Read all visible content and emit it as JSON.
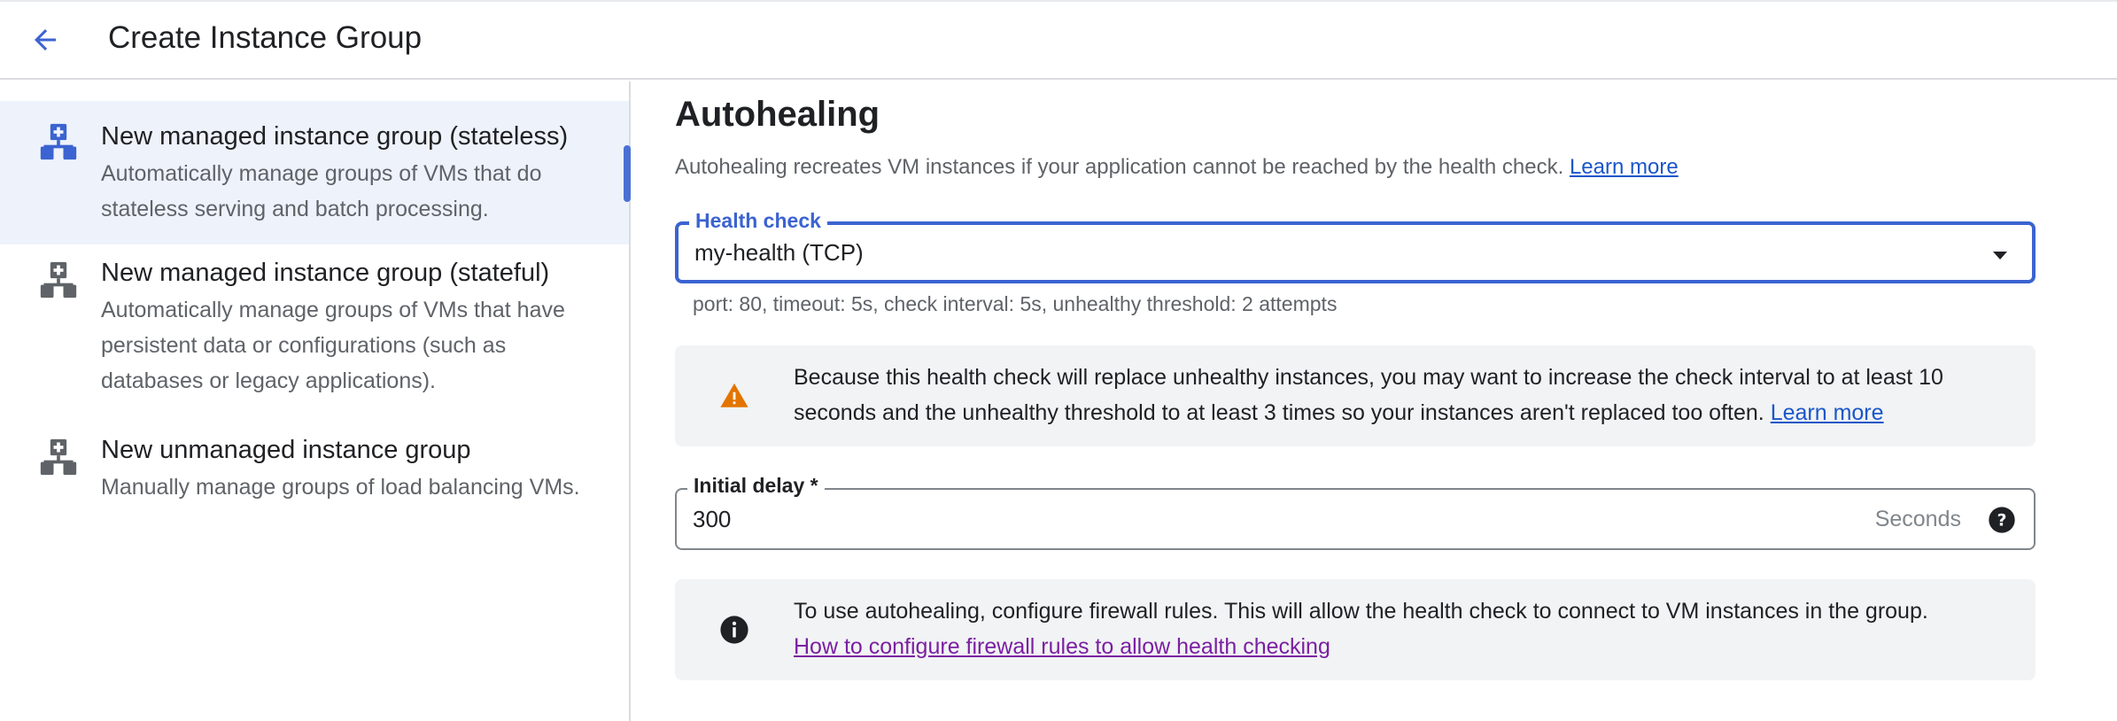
{
  "header": {
    "back_icon": "arrow-back-icon",
    "title": "Create Instance Group"
  },
  "sidebar": {
    "items": [
      {
        "title": "New managed instance group (stateless)",
        "description": "Automatically manage groups of VMs that do stateless serving and batch processing.",
        "icon": "managed-group-icon",
        "selected": true
      },
      {
        "title": "New managed instance group (stateful)",
        "description": "Automatically manage groups of VMs that have persistent data or configurations (such as databases or legacy applications).",
        "icon": "managed-group-icon",
        "selected": false
      },
      {
        "title": "New unmanaged instance group",
        "description": "Manually manage groups of load balancing VMs.",
        "icon": "unmanaged-group-icon",
        "selected": false
      }
    ]
  },
  "autohealing": {
    "title": "Autohealing",
    "description": "Autohealing recreates VM instances if your application cannot be reached by the health check.",
    "learn_more": "Learn more",
    "health_check": {
      "label": "Health check",
      "value": "my-health (TCP)",
      "details": "port: 80, timeout: 5s, check interval: 5s, unhealthy threshold: 2 attempts"
    },
    "warning": {
      "text": "Because this health check will replace unhealthy instances, you may want to increase the check interval to at least 10 seconds and the unhealthy threshold to at least 3 times so your instances aren't replaced too often.",
      "link": "Learn more",
      "icon": "warning-icon"
    },
    "initial_delay": {
      "label": "Initial delay *",
      "value": "300",
      "suffix": "Seconds",
      "help_icon": "help-icon"
    },
    "info": {
      "text": "To use autohealing, configure firewall rules. This will allow the health check to connect to VM instances in the group.",
      "link": "How to configure firewall rules to allow health checking",
      "icon": "info-icon"
    }
  },
  "colors": {
    "accent": "#3b63d1",
    "selected_bg": "#eef2fb",
    "warning": "#e37400",
    "visited_link": "#7b1fa2"
  }
}
